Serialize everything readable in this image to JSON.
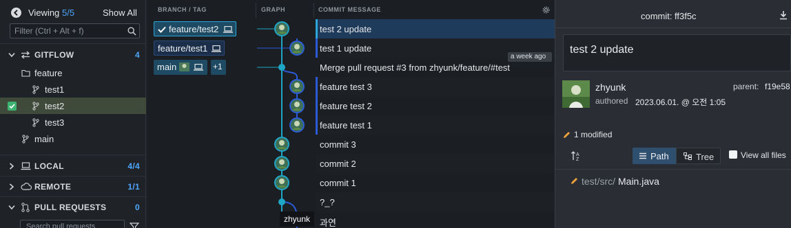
{
  "left": {
    "viewing_label": "Viewing",
    "viewing_count": "5/5",
    "show_all": "Show All",
    "filter_placeholder": "Filter (Ctrl + Alt + f)",
    "gitflow": {
      "label": "GITFLOW",
      "count": "4"
    },
    "tree": [
      {
        "label": "feature"
      },
      {
        "label": "test1"
      },
      {
        "label": "test2"
      },
      {
        "label": "test3"
      },
      {
        "label": "main"
      }
    ],
    "local": {
      "label": "LOCAL",
      "count": "4/4"
    },
    "remote": {
      "label": "REMOTE",
      "count": "1/1"
    },
    "pull_requests": {
      "label": "PULL REQUESTS",
      "count": "0"
    },
    "bottom_input_fragment": "Search pull requests"
  },
  "graph": {
    "headers": {
      "branch": "BRANCH / TAG",
      "graph": "GRAPH",
      "message": "COMMIT MESSAGE"
    },
    "branches": {
      "feature_test2": "feature/test2",
      "feature_test1": "feature/test1",
      "main": "main",
      "plus": "+1"
    },
    "timestamp_badge": "a week ago",
    "tooltip": "zhyunk",
    "commits": [
      "test 2 update",
      "test 1 update",
      "Merge pull request #3 from zhyunk/feature/#test",
      "feature test 3",
      "feature test 2",
      "feature test 1",
      "commit 3",
      "commit 2",
      "commit 1",
      "?_?",
      "과연"
    ]
  },
  "detail": {
    "commit_label": "commit:",
    "commit_sha": "ff3f5c",
    "summary": "test 2 update",
    "author": "zhyunk",
    "parent_label": "parent:",
    "parent_sha": "f19e58",
    "authored_label": "authored",
    "authored_date": "2023.06.01. @ 오전 1:05",
    "modified": "1 modified",
    "path_btn": "Path",
    "tree_btn": "Tree",
    "view_all": "View all files",
    "file_dir": "test/src/",
    "file_name": "Main.java"
  },
  "colors": {
    "accent": "#4ea7ff",
    "graph_line": "#1fa6c7",
    "selected_row": "#1e3b5b",
    "branch_pill": "#1e4a63"
  }
}
